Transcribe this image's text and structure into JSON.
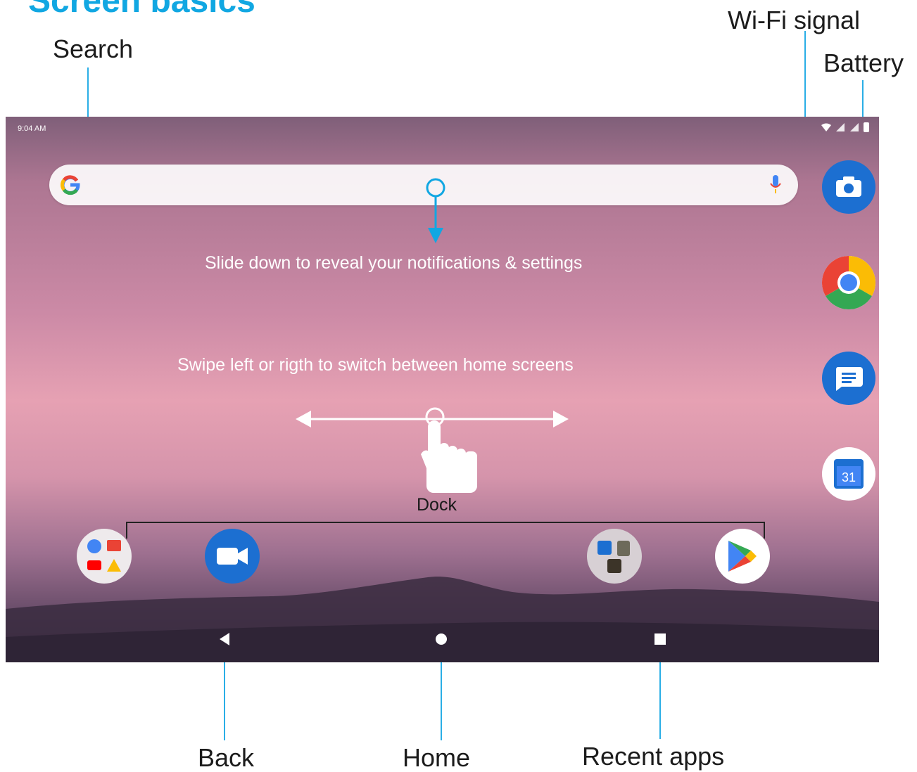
{
  "page": {
    "title": "Screen basics"
  },
  "callouts": {
    "search": "Search",
    "wifi": "Wi-Fi signal",
    "battery": "Battery",
    "back": "Back",
    "home": "Home",
    "recent": "Recent apps",
    "dock": "Dock"
  },
  "status_bar": {
    "time": "9:04 AM"
  },
  "hints": {
    "slide_down": "Slide down to reveal your notifications & settings",
    "swipe": "Swipe left or rigth to switch between home screens"
  },
  "side_apps": [
    "camera-icon",
    "chrome-icon",
    "messages-icon",
    "calendar-icon"
  ],
  "calendar_date": "31",
  "dock_apps": [
    "google-folder-icon",
    "duo-icon",
    "tools-folder-icon",
    "play-store-icon"
  ],
  "nav_buttons": [
    "back-icon",
    "home-icon",
    "recent-apps-icon"
  ],
  "colors": {
    "accent": "#11a7e2",
    "leader": "#2aaee6",
    "app_blue": "#1c6fd1"
  }
}
